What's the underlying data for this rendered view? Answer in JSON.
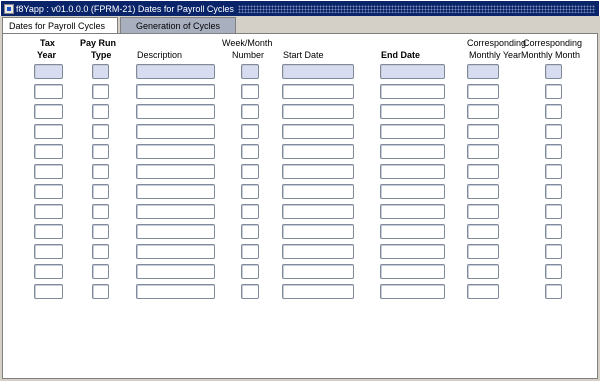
{
  "window": {
    "title": "f8Yapp : v01.0.0.0 (FPRM-21) Dates for Payroll Cycles"
  },
  "tabs": [
    {
      "label": "Dates for Payroll Cycles",
      "active": true
    },
    {
      "label": "Generation of Cycles",
      "active": false
    }
  ],
  "columns": {
    "tax_year": {
      "line1": "Tax",
      "line2": "Year"
    },
    "pay_run_type": {
      "line1": "Pay Run",
      "line2": "Type"
    },
    "description": {
      "line1": "Description"
    },
    "week_month_number": {
      "line1": "Week/Month",
      "line2": "Number"
    },
    "start_date": {
      "line1": "Start Date"
    },
    "end_date": {
      "line1": "End Date"
    },
    "corresponding_monthly_year": {
      "line1": "Corresponding",
      "line2": "Monthly Year"
    },
    "corresponding_monthly_month": {
      "line1": "Corresponding",
      "line2": "Monthly Month"
    }
  },
  "rows": [
    {
      "tax_year": "",
      "pay_run_type": "",
      "description": "",
      "week_month_number": "",
      "start_date": "",
      "end_date": "",
      "corresponding_monthly_year": "",
      "corresponding_monthly_month": ""
    },
    {
      "tax_year": "",
      "pay_run_type": "",
      "description": "",
      "week_month_number": "",
      "start_date": "",
      "end_date": "",
      "corresponding_monthly_year": "",
      "corresponding_monthly_month": ""
    },
    {
      "tax_year": "",
      "pay_run_type": "",
      "description": "",
      "week_month_number": "",
      "start_date": "",
      "end_date": "",
      "corresponding_monthly_year": "",
      "corresponding_monthly_month": ""
    },
    {
      "tax_year": "",
      "pay_run_type": "",
      "description": "",
      "week_month_number": "",
      "start_date": "",
      "end_date": "",
      "corresponding_monthly_year": "",
      "corresponding_monthly_month": ""
    },
    {
      "tax_year": "",
      "pay_run_type": "",
      "description": "",
      "week_month_number": "",
      "start_date": "",
      "end_date": "",
      "corresponding_monthly_year": "",
      "corresponding_monthly_month": ""
    },
    {
      "tax_year": "",
      "pay_run_type": "",
      "description": "",
      "week_month_number": "",
      "start_date": "",
      "end_date": "",
      "corresponding_monthly_year": "",
      "corresponding_monthly_month": ""
    },
    {
      "tax_year": "",
      "pay_run_type": "",
      "description": "",
      "week_month_number": "",
      "start_date": "",
      "end_date": "",
      "corresponding_monthly_year": "",
      "corresponding_monthly_month": ""
    },
    {
      "tax_year": "",
      "pay_run_type": "",
      "description": "",
      "week_month_number": "",
      "start_date": "",
      "end_date": "",
      "corresponding_monthly_year": "",
      "corresponding_monthly_month": ""
    },
    {
      "tax_year": "",
      "pay_run_type": "",
      "description": "",
      "week_month_number": "",
      "start_date": "",
      "end_date": "",
      "corresponding_monthly_year": "",
      "corresponding_monthly_month": ""
    },
    {
      "tax_year": "",
      "pay_run_type": "",
      "description": "",
      "week_month_number": "",
      "start_date": "",
      "end_date": "",
      "corresponding_monthly_year": "",
      "corresponding_monthly_month": ""
    },
    {
      "tax_year": "",
      "pay_run_type": "",
      "description": "",
      "week_month_number": "",
      "start_date": "",
      "end_date": "",
      "corresponding_monthly_year": "",
      "corresponding_monthly_month": ""
    },
    {
      "tax_year": "",
      "pay_run_type": "",
      "description": "",
      "week_month_number": "",
      "start_date": "",
      "end_date": "",
      "corresponding_monthly_year": "",
      "corresponding_monthly_month": ""
    }
  ]
}
